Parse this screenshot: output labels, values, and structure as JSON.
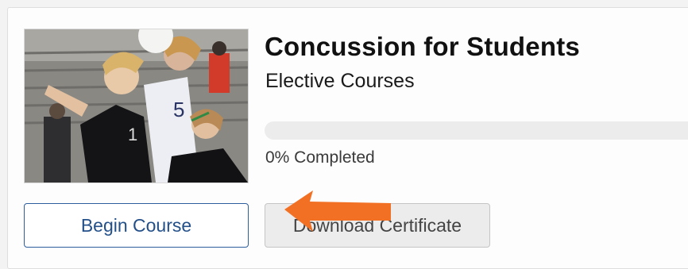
{
  "course": {
    "title": "Concussion for Students",
    "category": "Elective Courses",
    "progress_percent": 0,
    "progress_label": "0% Completed",
    "thumbnail_alt": "Soccer players heading the ball"
  },
  "actions": {
    "begin_label": "Begin Course",
    "download_label": "Download Certificate"
  },
  "colors": {
    "primary": "#2d5d9c",
    "arrow": "#f27024",
    "progress_track": "#ececec"
  },
  "icons": {
    "annotation": "arrow-left-icon"
  }
}
